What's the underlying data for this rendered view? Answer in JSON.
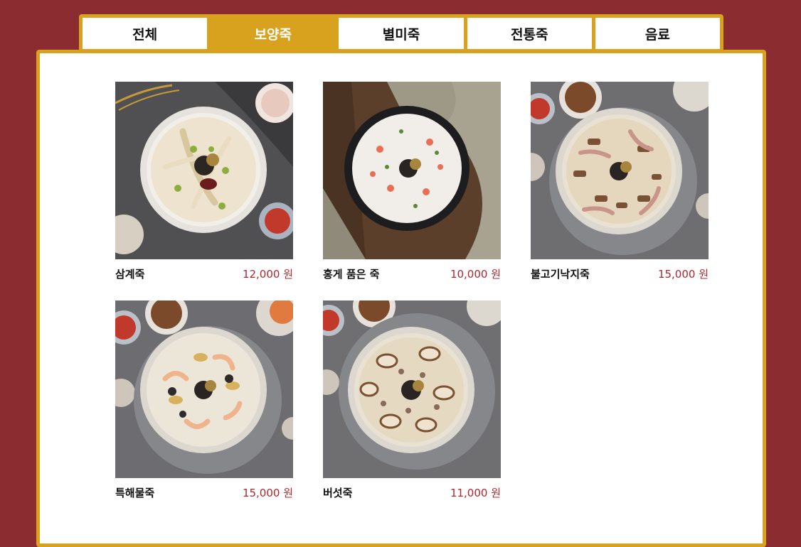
{
  "tabs": [
    {
      "label": "전체",
      "active": false
    },
    {
      "label": "보양죽",
      "active": true
    },
    {
      "label": "별미죽",
      "active": false
    },
    {
      "label": "전통죽",
      "active": false
    },
    {
      "label": "음료",
      "active": false
    }
  ],
  "colors": {
    "background": "#8b2c30",
    "accent": "#d9a21e",
    "price": "#b3262c"
  },
  "menu": [
    {
      "name": "삼계죽",
      "price": "12,000 원",
      "image_icon": "chicken-porridge-photo"
    },
    {
      "name": "홍게 품은 죽",
      "price": "10,000 원",
      "image_icon": "red-crab-porridge-photo"
    },
    {
      "name": "불고기낙지죽",
      "price": "15,000 원",
      "image_icon": "bulgogi-octopus-porridge-photo"
    },
    {
      "name": "특해물죽",
      "price": "15,000 원",
      "image_icon": "special-seafood-porridge-photo"
    },
    {
      "name": "버섯죽",
      "price": "11,000 원",
      "image_icon": "mushroom-porridge-photo"
    }
  ]
}
